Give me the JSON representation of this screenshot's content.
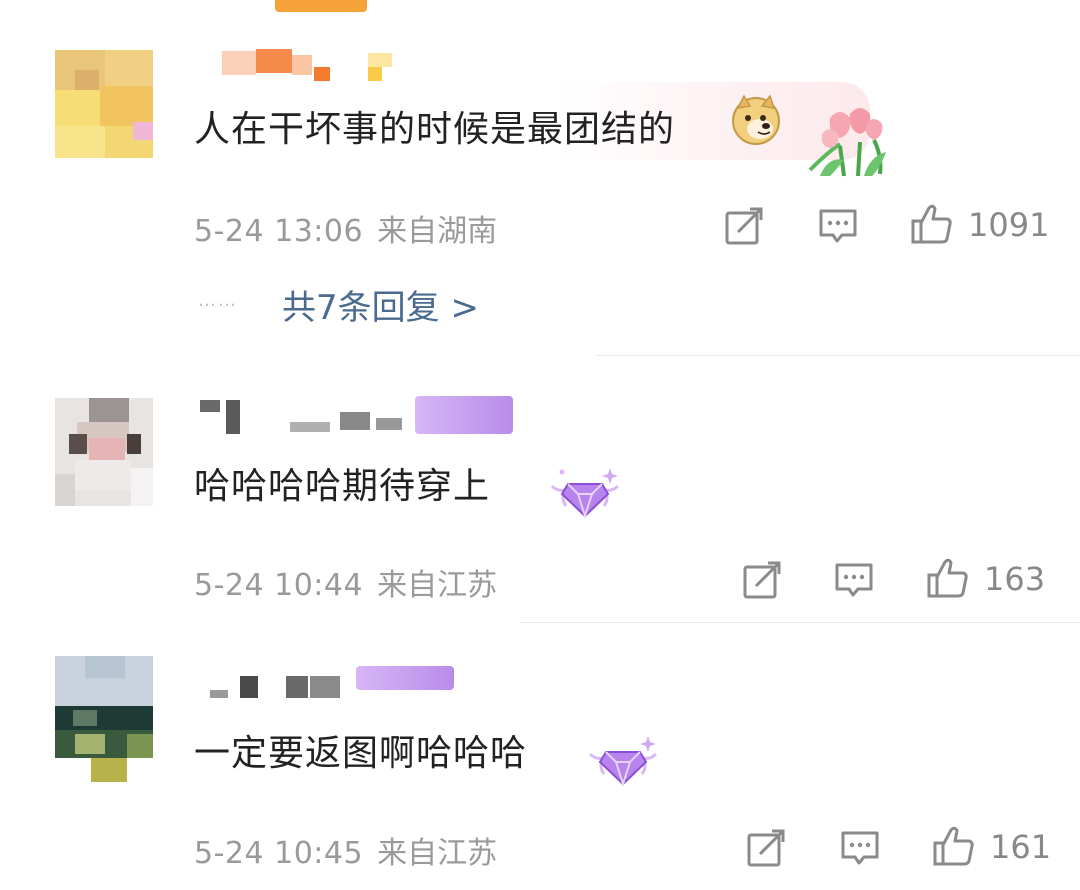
{
  "comments": [
    {
      "text": "人在干坏事的时候是最团结的",
      "date": "5-24 13:06",
      "location": "来自湖南",
      "likes": "1091",
      "replies_label": "共7条回复 >",
      "emoji": "doge-icon",
      "decoration": "tulip-icon"
    },
    {
      "text": "哈哈哈哈期待穿上",
      "date": "5-24 10:44",
      "location": "来自江苏",
      "likes": "163",
      "decoration": "purple-diamond-badge"
    },
    {
      "text": "一定要返图啊哈哈哈",
      "date": "5-24 10:45",
      "location": "来自江苏",
      "likes": "161",
      "decoration": "purple-diamond-badge"
    }
  ],
  "reply_dots": "……",
  "icons": {
    "share": "share-icon",
    "comment": "comment-icon",
    "like": "thumbs-up-icon"
  },
  "colors": {
    "link": "#4b6b8e",
    "meta": "#9a9a9a",
    "text": "#222222",
    "accent_orange": "#f6a23a",
    "badge_purple": "#b98ce8"
  }
}
